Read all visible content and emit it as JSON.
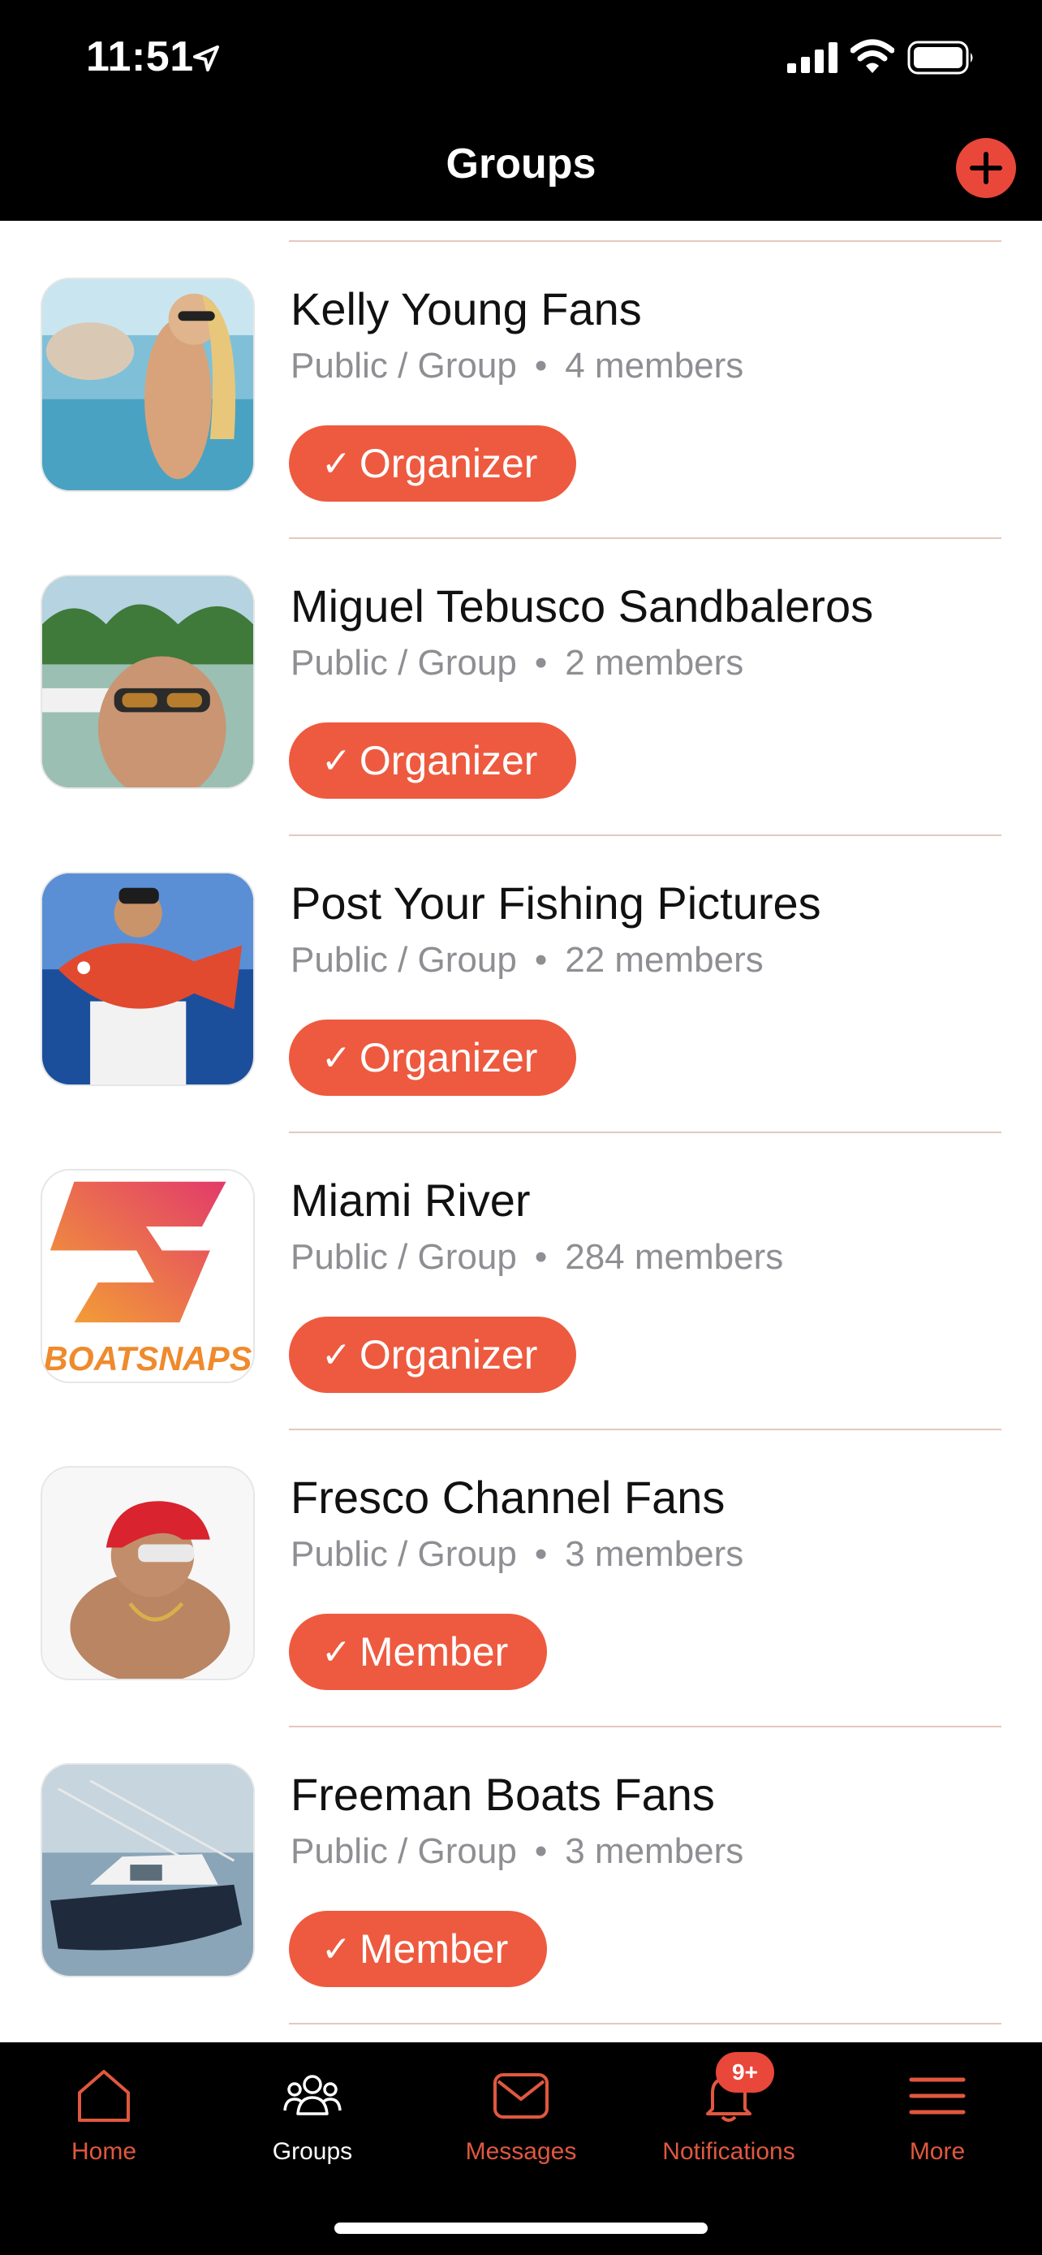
{
  "status_bar": {
    "time": "11:51"
  },
  "header": {
    "title": "Groups"
  },
  "groups": [
    {
      "name": "Kelly Young Fans",
      "visibility": "Public / Group",
      "members": "4 members",
      "role": "Organizer"
    },
    {
      "name": "Miguel Tebusco Sandbaleros",
      "visibility": "Public / Group",
      "members": "2 members",
      "role": "Organizer"
    },
    {
      "name": "Post Your Fishing Pictures",
      "visibility": "Public / Group",
      "members": "22 members",
      "role": "Organizer"
    },
    {
      "name": "Miami River",
      "visibility": "Public / Group",
      "members": "284 members",
      "role": "Organizer",
      "logo_text": "BOATSNAPS"
    },
    {
      "name": "Fresco Channel Fans",
      "visibility": "Public / Group",
      "members": "3 members",
      "role": "Member"
    },
    {
      "name": "Freeman Boats Fans",
      "visibility": "Public / Group",
      "members": "3 members",
      "role": "Member"
    }
  ],
  "tabs": [
    {
      "label": "Home",
      "icon": "home-icon"
    },
    {
      "label": "Groups",
      "icon": "groups-icon",
      "active": true
    },
    {
      "label": "Messages",
      "icon": "messages-icon"
    },
    {
      "label": "Notifications",
      "icon": "bell-icon",
      "badge": "9+"
    },
    {
      "label": "More",
      "icon": "menu-icon"
    }
  ],
  "colors": {
    "accent": "#ee5a3f",
    "add_button": "#e8473a",
    "tab_inactive": "#e0583f",
    "meta_text": "#8e8e93"
  }
}
